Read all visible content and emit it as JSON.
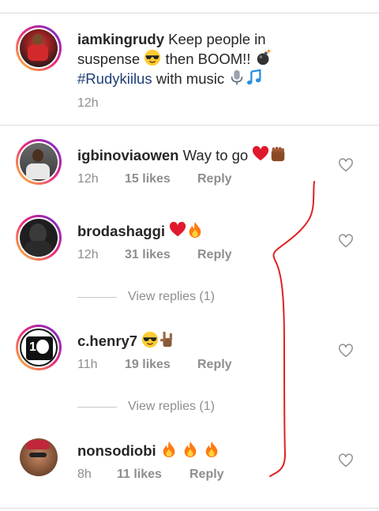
{
  "caption": {
    "username": "iamkingrudy",
    "text_part1": " Keep people in suspense ",
    "text_part2": " then BOOM!! ",
    "hashtag": "#Rudykiilus",
    "text_part3": " with music ",
    "time": "12h",
    "emojis": [
      "sunglasses-emoji",
      "bomb-emoji",
      "microphone-emoji",
      "music-note-emoji"
    ]
  },
  "comments": [
    {
      "username": "igbinoviaowen",
      "text": " Way to go ",
      "emojis": [
        "red-heart-emoji",
        "raised-fist-emoji"
      ],
      "time": "12h",
      "likes": "15 likes",
      "reply": "Reply"
    },
    {
      "username": "brodashaggi",
      "text": " ",
      "emojis": [
        "red-heart-emoji",
        "fire-emoji"
      ],
      "time": "12h",
      "likes": "31 likes",
      "reply": "Reply",
      "view_replies": "View replies (1)"
    },
    {
      "username": "c.henry7",
      "text": " ",
      "emojis": [
        "sunglasses-emoji",
        "rock-hand-emoji"
      ],
      "time": "11h",
      "likes": "19 likes",
      "reply": "Reply",
      "view_replies": "View replies (1)"
    },
    {
      "username": "nonsodiobi",
      "text": " ",
      "emojis": [
        "fire-emoji",
        "fire-emoji",
        "fire-emoji"
      ],
      "time": "8h",
      "likes": "11 likes",
      "reply": "Reply"
    }
  ],
  "colors": {
    "hashtag": "#1d3f78",
    "meta_gray": "#8e8e8e",
    "annotation_red": "#e02020",
    "divider": "#dbdbdb"
  }
}
